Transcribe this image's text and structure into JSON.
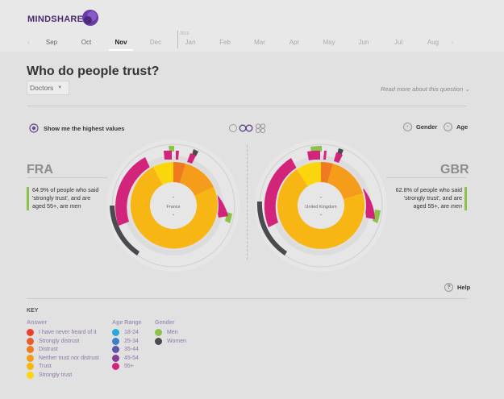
{
  "brand": {
    "name": "MINDSHARE",
    "accent": "#5b2d8c"
  },
  "timeline": {
    "prev_arrow": "‹",
    "next_arrow": "›",
    "year_label": "2013",
    "months": [
      "Sep",
      "Oct",
      "Nov",
      "Dec",
      "Jan",
      "Feb",
      "Mar",
      "Apr",
      "May",
      "Jun",
      "Jul",
      "Aug"
    ],
    "active_month": "Nov"
  },
  "question": {
    "title": "Who do people trust?",
    "selected_option": "Doctors",
    "read_more": "Read more about this question"
  },
  "options": {
    "highest_values": "Show me the highest values",
    "gender": "Gender",
    "age": "Age"
  },
  "countries": [
    {
      "code": "FRA",
      "name": "France",
      "stat_pre": "64.9% of people who said",
      "stat_mid": "'strongly trust', and are",
      "stat_end_pre": "aged 55+, are ",
      "stat_end_em": "men"
    },
    {
      "code": "GBR",
      "name": "United Kingdom",
      "stat_pre": "62.8% of people who said",
      "stat_mid": "'strongly trust', and are",
      "stat_end_pre": "aged 55+, are ",
      "stat_end_em": "men"
    }
  ],
  "help": "Help",
  "key": {
    "title": "KEY",
    "answer_head": "Answer",
    "age_head": "Age Range",
    "gender_head": "Gender",
    "answers": [
      {
        "label": "I have never heard of it",
        "color": "#e8402b"
      },
      {
        "label": "Strongly distrust",
        "color": "#e85d2a"
      },
      {
        "label": "Distrust",
        "color": "#f07a1f"
      },
      {
        "label": "Neither trust nor distrust",
        "color": "#f59c1a"
      },
      {
        "label": "Trust",
        "color": "#f8b614"
      },
      {
        "label": "Strongly trust",
        "color": "#fbd60c"
      }
    ],
    "ages": [
      {
        "label": "18-24",
        "color": "#29a8e0"
      },
      {
        "label": "25-34",
        "color": "#3f7fc6"
      },
      {
        "label": "35-44",
        "color": "#5a55ad"
      },
      {
        "label": "45-54",
        "color": "#8a3d96"
      },
      {
        "label": "55+",
        "color": "#d2247a"
      }
    ],
    "genders": [
      {
        "label": "Men",
        "color": "#8bc34a"
      },
      {
        "label": "Women",
        "color": "#4b4b4f"
      }
    ]
  }
}
